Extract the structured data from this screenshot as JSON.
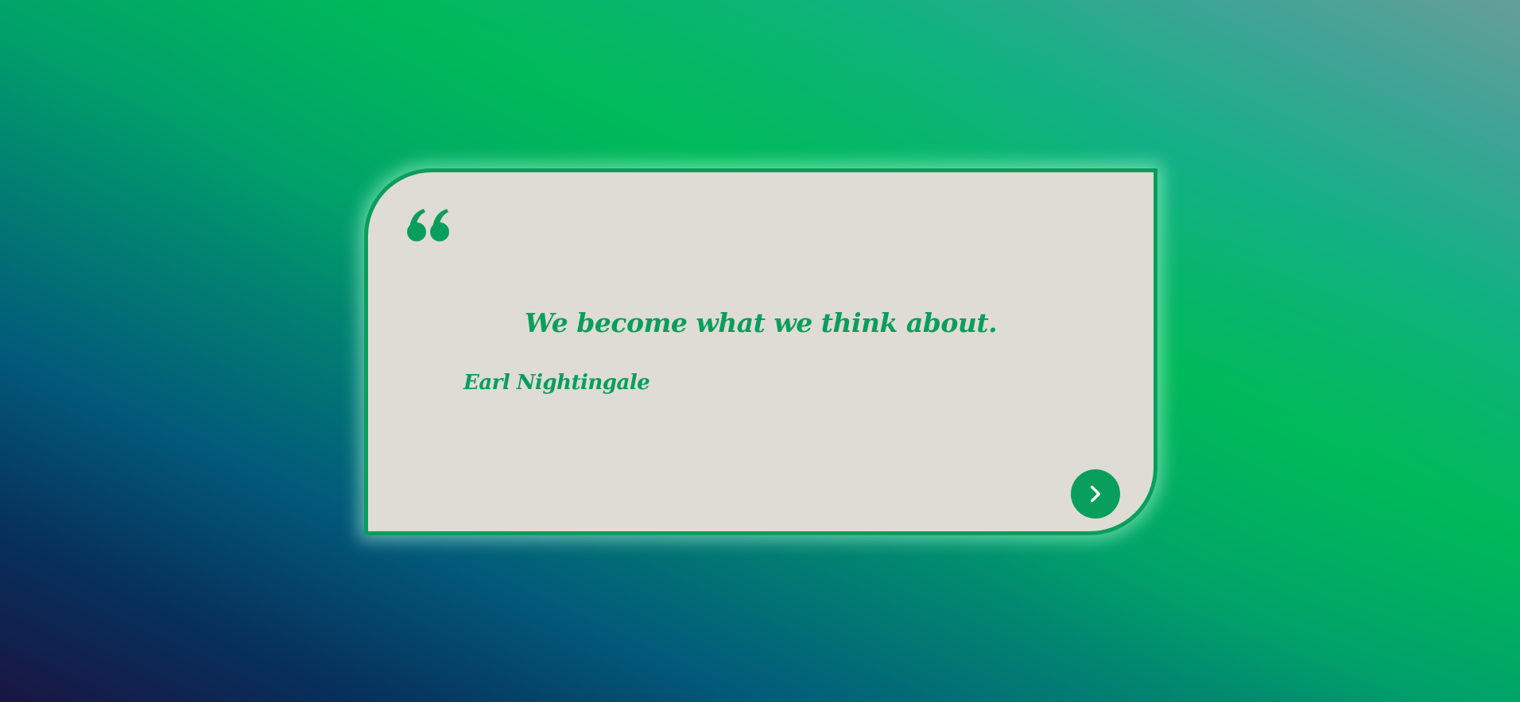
{
  "quote": {
    "text": "We become what we think about.",
    "author": "Earl Nightingale"
  },
  "icons": {
    "quote_mark": "quote-left-icon",
    "next": "chevron-right-icon"
  },
  "colors": {
    "accent": "#0a9e5c",
    "card_background": "#dfdcd6",
    "glow": "#b4ffdc"
  }
}
